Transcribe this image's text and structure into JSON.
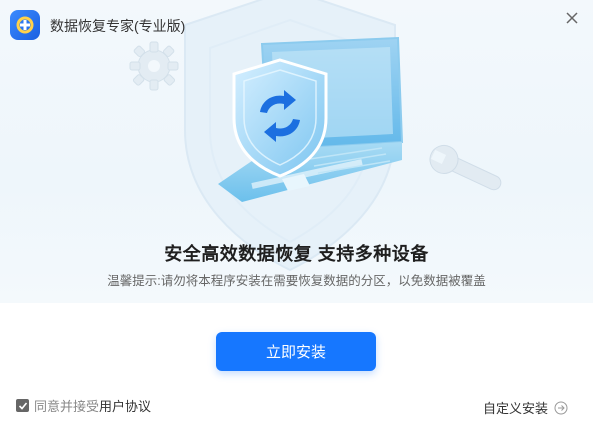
{
  "window": {
    "title": "数据恢复专家(专业版)"
  },
  "hero": {
    "headline": "安全高效数据恢复  支持多种设备",
    "tip": "温馨提示:请勿将本程序安装在需要恢复数据的分区，以免数据被覆盖"
  },
  "actions": {
    "install_label": "立即安装",
    "custom_install_label": "自定义安装"
  },
  "agreement": {
    "checked": true,
    "prefix": "同意并接受",
    "link": "用户协议"
  },
  "colors": {
    "accent": "#1677ff",
    "hero_bg": "#eef6fb"
  },
  "icons": [
    "app-logo-icon",
    "close-icon",
    "gear-icon",
    "wrench-icon",
    "laptop-illustration",
    "shield-refresh-icon",
    "checkbox-check-icon",
    "arrow-right-circle-icon"
  ]
}
